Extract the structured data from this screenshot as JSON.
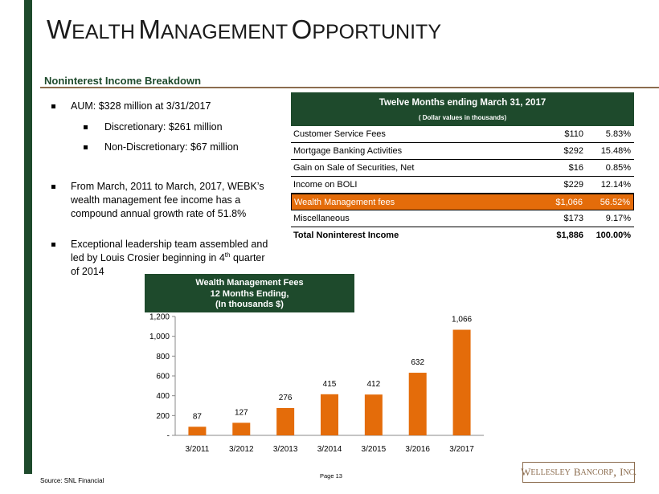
{
  "slide": {
    "title": {
      "cap1": "W",
      "rest1": "EALTH",
      "cap2": "M",
      "rest2": "ANAGEMENT",
      "cap3": "O",
      "rest3": "PPORTUNITY"
    },
    "subtitle": "Noninterest Income Breakdown",
    "source": "Source: SNL Financial",
    "page": "Page 13",
    "logo": {
      "c1": "W",
      "r1": "ELLESLEY",
      "c2": "B",
      "r2": "ANCORP",
      "c3": "I",
      "r3": "NC."
    }
  },
  "bullets": {
    "b1": "AUM: $328 million at 3/31/2017",
    "b1a": "Discretionary: $261 million",
    "b1b": "Non-Discretionary: $67 million",
    "b2": "From March, 2011 to March, 2017, WEBK’s wealth management fee income has a compound annual growth rate of 51.8%",
    "b3_pre": "Exceptional leadership team assembled and led by Louis Crosier beginning in 4",
    "b3_sup": "th",
    "b3_post": " quarter of 2014"
  },
  "table": {
    "header": "Twelve Months ending March 31, 2017",
    "subheader": "( Dollar values in thousands)",
    "rows": [
      {
        "label": "Customer Service Fees",
        "amount": "$110",
        "pct": "5.83%"
      },
      {
        "label": "Mortgage Banking Activities",
        "amount": "$292",
        "pct": "15.48%"
      },
      {
        "label": "Gain on Sale of Securities, Net",
        "amount": "$16",
        "pct": "0.85%"
      },
      {
        "label": "Income on BOLI",
        "amount": "$229",
        "pct": "12.14%"
      },
      {
        "label": "Wealth Management fees",
        "amount": "$1,066",
        "pct": "56.52%"
      },
      {
        "label": "Miscellaneous",
        "amount": "$173",
        "pct": "9.17%"
      },
      {
        "label": "Total Noninterest Income",
        "amount": "$1,886",
        "pct": "100.00%"
      }
    ]
  },
  "chart_header": {
    "l1": "Wealth Management Fees",
    "l2": "12 Months Ending,",
    "l3": "(In thousands $)"
  },
  "colors": {
    "bar": "#e46c0a",
    "header_green": "#1e4a2c",
    "rule": "#8c6d4f"
  },
  "chart_data": {
    "type": "bar",
    "categories": [
      "3/2011",
      "3/2012",
      "3/2013",
      "3/2014",
      "3/2015",
      "3/2016",
      "3/2017"
    ],
    "values": [
      87,
      127,
      276,
      415,
      412,
      632,
      1066
    ],
    "data_labels": [
      "87",
      "127",
      "276",
      "415",
      "412",
      "632",
      "1,066"
    ],
    "yticks": [
      0,
      200,
      400,
      600,
      800,
      1000,
      1200
    ],
    "ytick_labels": [
      "-",
      "200",
      "400",
      "600",
      "800",
      "1,000",
      "1,200"
    ],
    "ylim": [
      0,
      1200
    ],
    "title": "",
    "xlabel": "",
    "ylabel": "",
    "grid": false,
    "legend": "none"
  }
}
